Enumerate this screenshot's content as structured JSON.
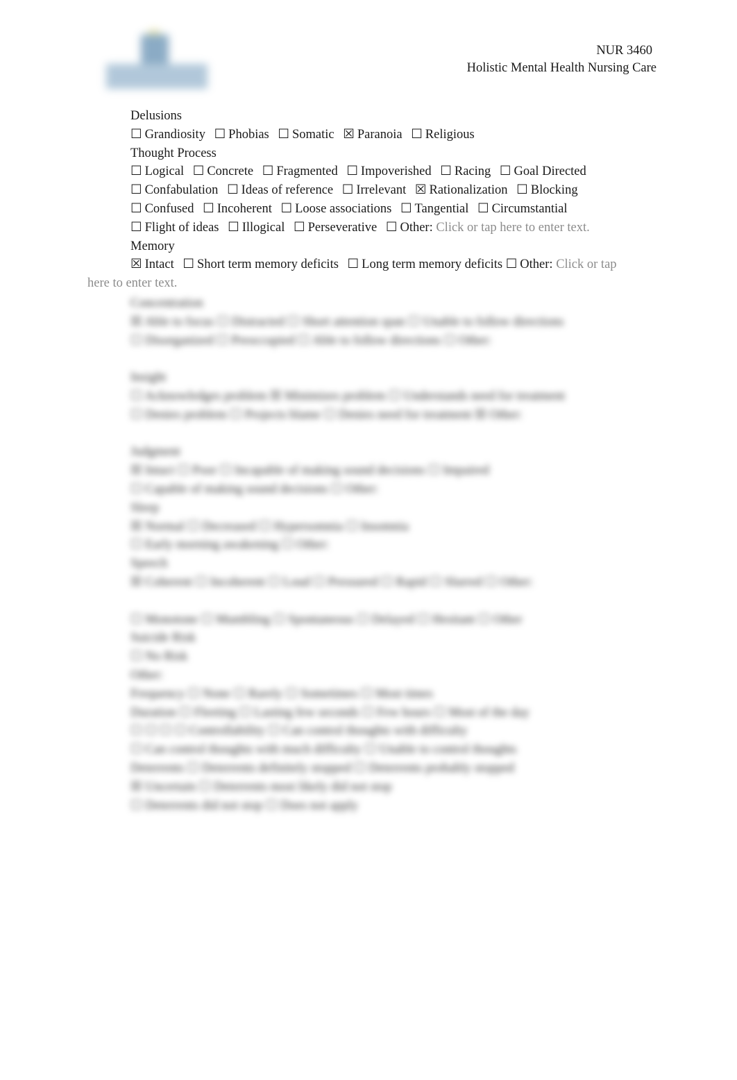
{
  "header": {
    "logo_icon": "university-logo-icon",
    "course_code": "NUR 3460",
    "course_title": "Holistic Mental Health Nursing Care"
  },
  "sections": {
    "delusions": {
      "title": "Delusions",
      "options": [
        {
          "label": "Grandiosity",
          "checked": false,
          "mark": "☐"
        },
        {
          "label": "Phobias",
          "checked": false,
          "mark": "☐"
        },
        {
          "label": "Somatic",
          "checked": false,
          "mark": "☐"
        },
        {
          "label": "Paranoia",
          "checked": true,
          "mark": "☒"
        },
        {
          "label": "Religious",
          "checked": false,
          "mark": "☐"
        }
      ]
    },
    "thought_process": {
      "title": "Thought Process",
      "rows": [
        [
          {
            "label": "Logical",
            "checked": false,
            "mark": "☐"
          },
          {
            "label": "Concrete",
            "checked": false,
            "mark": "☐"
          },
          {
            "label": "Fragmented",
            "checked": false,
            "mark": "☐"
          },
          {
            "label": "Impoverished",
            "checked": false,
            "mark": "☐"
          },
          {
            "label": "Racing",
            "checked": false,
            "mark": "☐"
          },
          {
            "label": "Goal Directed",
            "checked": false,
            "mark": "☐"
          }
        ],
        [
          {
            "label": "Confabulation",
            "checked": false,
            "mark": "☐"
          },
          {
            "label": "Ideas of reference",
            "checked": false,
            "mark": "☐"
          },
          {
            "label": "Irrelevant",
            "checked": false,
            "mark": "☐"
          },
          {
            "label": "Rationalization",
            "checked": true,
            "mark": "☒"
          },
          {
            "label": "Blocking",
            "checked": false,
            "mark": "☐"
          }
        ],
        [
          {
            "label": "Confused",
            "checked": false,
            "mark": "☐"
          },
          {
            "label": "Incoherent",
            "checked": false,
            "mark": "☐"
          },
          {
            "label": "Loose associations",
            "checked": false,
            "mark": "☐"
          },
          {
            "label": "Tangential",
            "checked": false,
            "mark": "☐"
          },
          {
            "label": "Circumstantial",
            "checked": false,
            "mark": "☐"
          }
        ],
        [
          {
            "label": "Flight of ideas",
            "checked": false,
            "mark": "☐"
          },
          {
            "label": "Illogical",
            "checked": false,
            "mark": "☐"
          },
          {
            "label": "Perseverative",
            "checked": false,
            "mark": "☐"
          },
          {
            "label": "Other:",
            "checked": false,
            "mark": "☐"
          }
        ]
      ],
      "other_placeholder": "Click or tap here to enter text."
    },
    "memory": {
      "title": "Memory",
      "options": [
        {
          "label": "Intact",
          "checked": true,
          "mark": "☒"
        },
        {
          "label": "Short term memory deficits",
          "checked": false,
          "mark": "☐"
        },
        {
          "label": "Long term memory deficits",
          "checked": false,
          "mark": "☐"
        },
        {
          "label": "Other:",
          "checked": false,
          "mark": "☐"
        }
      ],
      "other_placeholder_part1": "Click or tap",
      "other_placeholder_part2": "here to enter text."
    }
  },
  "blurred_region": {
    "note": "Remaining form content is blurred and illegible",
    "lines": [
      "Concentration",
      "☒ Able to focus ☐ Distracted ☐ Short attention span ☐ Unable to follow directions",
      "☐ Disorganized ☐ Preoccupied ☐ Able to follow directions ☐ Other:",
      "Insight",
      "☐ Acknowledges problem ☒ Minimizes problem ☐ Understands need for treatment",
      "☐ Denies problem ☐ Projects blame ☐ Denies need for treatment ☒ Other:",
      "Judgment",
      "☒ Intact ☐ Poor ☐ Incapable of making sound decisions ☐ Impaired",
      "☐ Capable of making sound decisions ☐ Other:",
      "Sleep",
      "☒ Normal ☐ Decreased ☐ Hypersomnia ☐ Insomnia",
      "☐ Early morning awakening ☐ Other:",
      "Speech",
      "☒ Coherent ☐ Incoherent ☐ Loud ☐ Pressured ☐ Rapid ☐ Slurred ☐ Other:",
      "☐ Monotone ☐ Mumbling ☐ Spontaneous ☐ Delayed ☐ Hesitant ☐ Other",
      "Suicide Risk",
      "☐ No Risk",
      "Other:",
      "Frequency ☐ None ☐ Rarely ☐ Sometimes ☐ Most times",
      "Duration ☐ Fleeting ☐ Lasting few seconds ☐ Few hours ☐ Most of the day",
      "☐ ☐ ☐ ☐ Controllability ☐ Can control thoughts with difficulty",
      "☐ Can control thoughts with much difficulty ☐ Unable to control thoughts",
      "Deterrents ☐ Deterrents definitely stopped ☐ Deterrents probably stopped",
      "☒ Uncertain ☐ Deterrents most likely did not stop",
      "☐ Deterrents did not stop ☐ Does not apply"
    ]
  }
}
